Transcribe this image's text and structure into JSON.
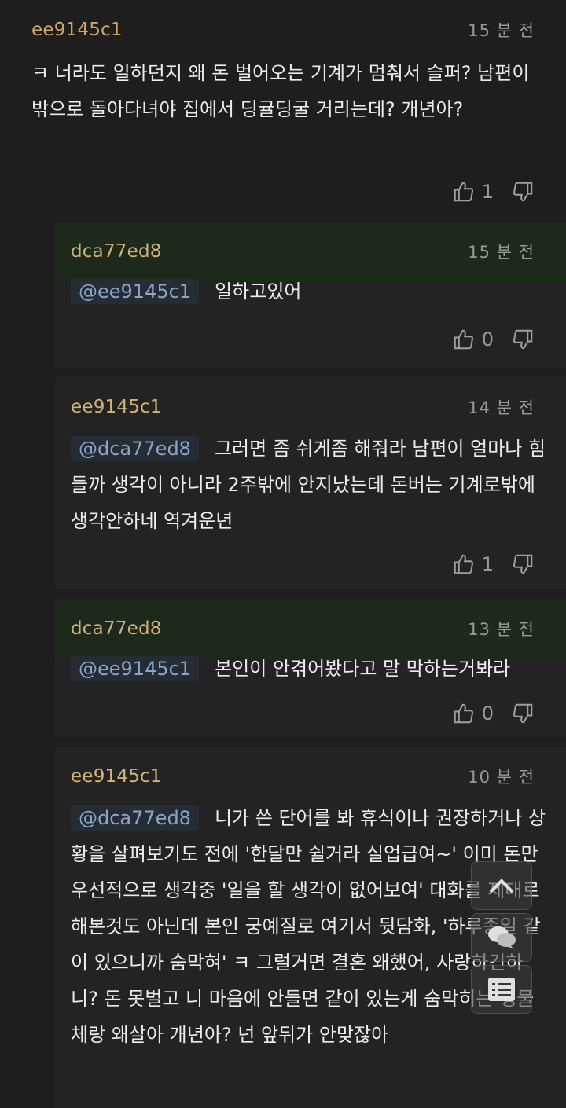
{
  "comments": [
    {
      "author": "ee9145c1",
      "time": "15 분 전",
      "mention": "",
      "text": "ㅋ 너라도 일하던지 왜 돈 벌어오는 기계가 멈춰서 슬퍼? 남편이 밖으로 돌아다녀야 집에서 딩귤딩굴 거리는데? 개년아?",
      "likes": "1"
    },
    {
      "author": "dca77ed8",
      "time": "15 분 전",
      "mention": "@ee9145c1",
      "text": "일하고있어",
      "likes": "0"
    },
    {
      "author": "ee9145c1",
      "time": "14 분 전",
      "mention": "@dca77ed8",
      "text": "그러면 좀 쉬게좀 해줘라 남편이 얼마나 힘들까 생각이 아니라 2주밖에 안지났는데 돈버는 기계로밖에 생각안하네 역겨운년",
      "likes": "1"
    },
    {
      "author": "dca77ed8",
      "time": "13 분 전",
      "mention": "@ee9145c1",
      "text": "본인이 안겪어봤다고 말 막하는거봐라",
      "likes": "0"
    },
    {
      "author": "ee9145c1",
      "time": "10 분 전",
      "mention": "@dca77ed8",
      "text": "니가 쓴 단어를 봐 휴식이나 권장하거나 상황을 살펴보기도 전에 '한달만 쉴거라 실업급여~' 이미 돈만 우선적으로 생각중 '일을 할 생각이 없어보여' 대화를 제대로 해본것도 아닌데 본인 궁예질로 여기서 뒷담화, '하루종일 같이 있으니까 숨막혀' ㅋ 그럴거면 결혼 왜했어, 사랑하긴하니? 돈 못벌고 니 마음에 안들면 같이 있는게 숨막히는 생물체랑 왜살아 개년아? 넌 앞뒤가 안맞잖아",
      "likes": ""
    }
  ],
  "icons": {
    "like": "thumbs-up-icon",
    "dislike": "thumbs-down-icon"
  },
  "floating": [
    "scroll-top-icon",
    "chat-icon",
    "list-icon"
  ]
}
